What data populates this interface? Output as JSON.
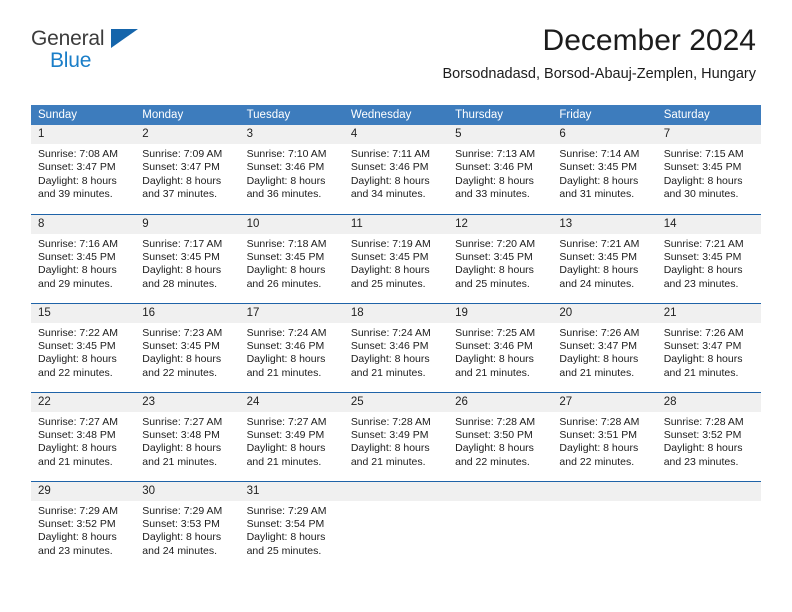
{
  "brand": {
    "name_line1": "General",
    "name_line2": "Blue",
    "logo_icon": "triangle-logo-icon",
    "accent_color": "#1a7ec8",
    "triangle_color": "#1565ab"
  },
  "header": {
    "month_title": "December 2024",
    "location": "Borsodnadasd, Borsod-Abauj-Zemplen, Hungary"
  },
  "theme": {
    "header_row_bg": "#3d7cbd",
    "row_divider": "#1f63a8",
    "daynum_bg": "#f0f0f0",
    "text_color": "#1c1c1c"
  },
  "weekday_headers": [
    "Sunday",
    "Monday",
    "Tuesday",
    "Wednesday",
    "Thursday",
    "Friday",
    "Saturday"
  ],
  "weeks": [
    [
      {
        "day": "1",
        "sunrise": "Sunrise: 7:08 AM",
        "sunset": "Sunset: 3:47 PM",
        "daylight1": "Daylight: 8 hours",
        "daylight2": "and 39 minutes."
      },
      {
        "day": "2",
        "sunrise": "Sunrise: 7:09 AM",
        "sunset": "Sunset: 3:47 PM",
        "daylight1": "Daylight: 8 hours",
        "daylight2": "and 37 minutes."
      },
      {
        "day": "3",
        "sunrise": "Sunrise: 7:10 AM",
        "sunset": "Sunset: 3:46 PM",
        "daylight1": "Daylight: 8 hours",
        "daylight2": "and 36 minutes."
      },
      {
        "day": "4",
        "sunrise": "Sunrise: 7:11 AM",
        "sunset": "Sunset: 3:46 PM",
        "daylight1": "Daylight: 8 hours",
        "daylight2": "and 34 minutes."
      },
      {
        "day": "5",
        "sunrise": "Sunrise: 7:13 AM",
        "sunset": "Sunset: 3:46 PM",
        "daylight1": "Daylight: 8 hours",
        "daylight2": "and 33 minutes."
      },
      {
        "day": "6",
        "sunrise": "Sunrise: 7:14 AM",
        "sunset": "Sunset: 3:45 PM",
        "daylight1": "Daylight: 8 hours",
        "daylight2": "and 31 minutes."
      },
      {
        "day": "7",
        "sunrise": "Sunrise: 7:15 AM",
        "sunset": "Sunset: 3:45 PM",
        "daylight1": "Daylight: 8 hours",
        "daylight2": "and 30 minutes."
      }
    ],
    [
      {
        "day": "8",
        "sunrise": "Sunrise: 7:16 AM",
        "sunset": "Sunset: 3:45 PM",
        "daylight1": "Daylight: 8 hours",
        "daylight2": "and 29 minutes."
      },
      {
        "day": "9",
        "sunrise": "Sunrise: 7:17 AM",
        "sunset": "Sunset: 3:45 PM",
        "daylight1": "Daylight: 8 hours",
        "daylight2": "and 28 minutes."
      },
      {
        "day": "10",
        "sunrise": "Sunrise: 7:18 AM",
        "sunset": "Sunset: 3:45 PM",
        "daylight1": "Daylight: 8 hours",
        "daylight2": "and 26 minutes."
      },
      {
        "day": "11",
        "sunrise": "Sunrise: 7:19 AM",
        "sunset": "Sunset: 3:45 PM",
        "daylight1": "Daylight: 8 hours",
        "daylight2": "and 25 minutes."
      },
      {
        "day": "12",
        "sunrise": "Sunrise: 7:20 AM",
        "sunset": "Sunset: 3:45 PM",
        "daylight1": "Daylight: 8 hours",
        "daylight2": "and 25 minutes."
      },
      {
        "day": "13",
        "sunrise": "Sunrise: 7:21 AM",
        "sunset": "Sunset: 3:45 PM",
        "daylight1": "Daylight: 8 hours",
        "daylight2": "and 24 minutes."
      },
      {
        "day": "14",
        "sunrise": "Sunrise: 7:21 AM",
        "sunset": "Sunset: 3:45 PM",
        "daylight1": "Daylight: 8 hours",
        "daylight2": "and 23 minutes."
      }
    ],
    [
      {
        "day": "15",
        "sunrise": "Sunrise: 7:22 AM",
        "sunset": "Sunset: 3:45 PM",
        "daylight1": "Daylight: 8 hours",
        "daylight2": "and 22 minutes."
      },
      {
        "day": "16",
        "sunrise": "Sunrise: 7:23 AM",
        "sunset": "Sunset: 3:45 PM",
        "daylight1": "Daylight: 8 hours",
        "daylight2": "and 22 minutes."
      },
      {
        "day": "17",
        "sunrise": "Sunrise: 7:24 AM",
        "sunset": "Sunset: 3:46 PM",
        "daylight1": "Daylight: 8 hours",
        "daylight2": "and 21 minutes."
      },
      {
        "day": "18",
        "sunrise": "Sunrise: 7:24 AM",
        "sunset": "Sunset: 3:46 PM",
        "daylight1": "Daylight: 8 hours",
        "daylight2": "and 21 minutes."
      },
      {
        "day": "19",
        "sunrise": "Sunrise: 7:25 AM",
        "sunset": "Sunset: 3:46 PM",
        "daylight1": "Daylight: 8 hours",
        "daylight2": "and 21 minutes."
      },
      {
        "day": "20",
        "sunrise": "Sunrise: 7:26 AM",
        "sunset": "Sunset: 3:47 PM",
        "daylight1": "Daylight: 8 hours",
        "daylight2": "and 21 minutes."
      },
      {
        "day": "21",
        "sunrise": "Sunrise: 7:26 AM",
        "sunset": "Sunset: 3:47 PM",
        "daylight1": "Daylight: 8 hours",
        "daylight2": "and 21 minutes."
      }
    ],
    [
      {
        "day": "22",
        "sunrise": "Sunrise: 7:27 AM",
        "sunset": "Sunset: 3:48 PM",
        "daylight1": "Daylight: 8 hours",
        "daylight2": "and 21 minutes."
      },
      {
        "day": "23",
        "sunrise": "Sunrise: 7:27 AM",
        "sunset": "Sunset: 3:48 PM",
        "daylight1": "Daylight: 8 hours",
        "daylight2": "and 21 minutes."
      },
      {
        "day": "24",
        "sunrise": "Sunrise: 7:27 AM",
        "sunset": "Sunset: 3:49 PM",
        "daylight1": "Daylight: 8 hours",
        "daylight2": "and 21 minutes."
      },
      {
        "day": "25",
        "sunrise": "Sunrise: 7:28 AM",
        "sunset": "Sunset: 3:49 PM",
        "daylight1": "Daylight: 8 hours",
        "daylight2": "and 21 minutes."
      },
      {
        "day": "26",
        "sunrise": "Sunrise: 7:28 AM",
        "sunset": "Sunset: 3:50 PM",
        "daylight1": "Daylight: 8 hours",
        "daylight2": "and 22 minutes."
      },
      {
        "day": "27",
        "sunrise": "Sunrise: 7:28 AM",
        "sunset": "Sunset: 3:51 PM",
        "daylight1": "Daylight: 8 hours",
        "daylight2": "and 22 minutes."
      },
      {
        "day": "28",
        "sunrise": "Sunrise: 7:28 AM",
        "sunset": "Sunset: 3:52 PM",
        "daylight1": "Daylight: 8 hours",
        "daylight2": "and 23 minutes."
      }
    ],
    [
      {
        "day": "29",
        "sunrise": "Sunrise: 7:29 AM",
        "sunset": "Sunset: 3:52 PM",
        "daylight1": "Daylight: 8 hours",
        "daylight2": "and 23 minutes."
      },
      {
        "day": "30",
        "sunrise": "Sunrise: 7:29 AM",
        "sunset": "Sunset: 3:53 PM",
        "daylight1": "Daylight: 8 hours",
        "daylight2": "and 24 minutes."
      },
      {
        "day": "31",
        "sunrise": "Sunrise: 7:29 AM",
        "sunset": "Sunset: 3:54 PM",
        "daylight1": "Daylight: 8 hours",
        "daylight2": "and 25 minutes."
      },
      {
        "day": "",
        "sunrise": "",
        "sunset": "",
        "daylight1": "",
        "daylight2": ""
      },
      {
        "day": "",
        "sunrise": "",
        "sunset": "",
        "daylight1": "",
        "daylight2": ""
      },
      {
        "day": "",
        "sunrise": "",
        "sunset": "",
        "daylight1": "",
        "daylight2": ""
      },
      {
        "day": "",
        "sunrise": "",
        "sunset": "",
        "daylight1": "",
        "daylight2": ""
      }
    ]
  ]
}
